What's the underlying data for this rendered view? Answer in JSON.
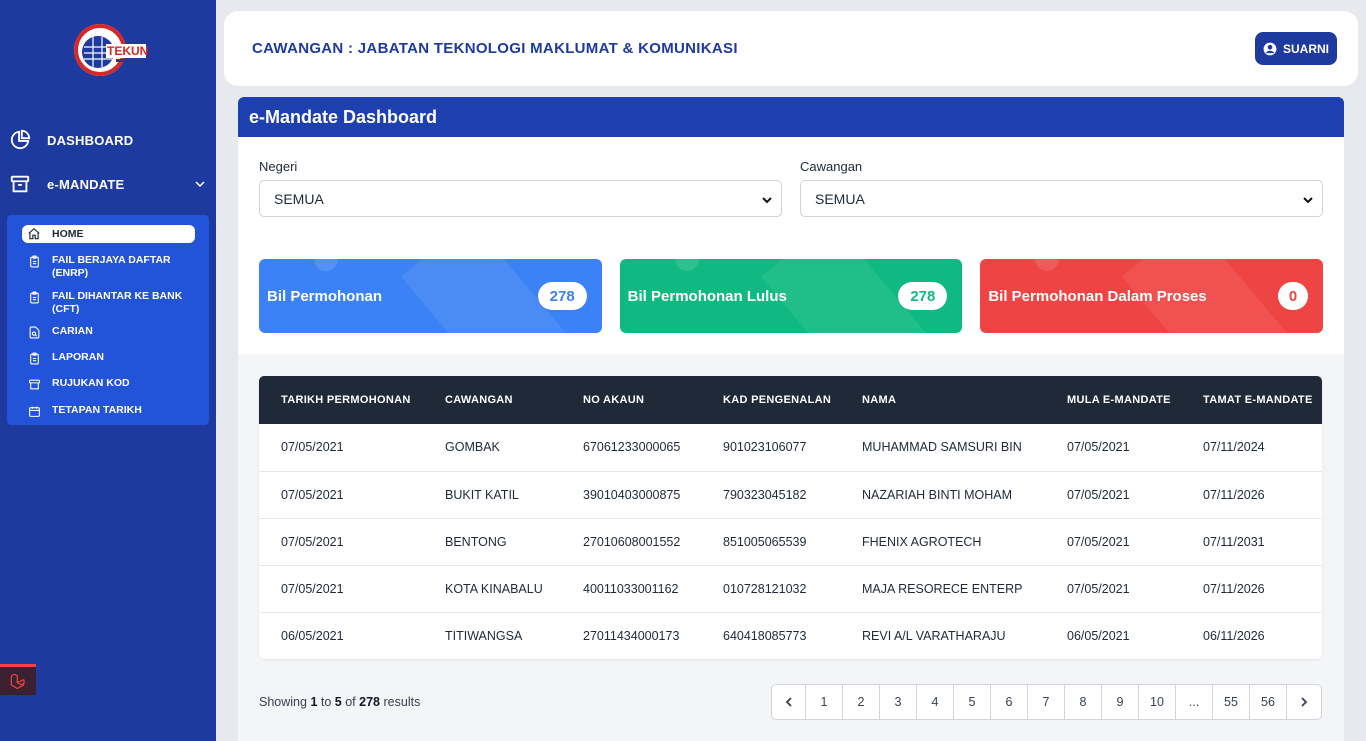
{
  "sidebar": {
    "logo_text": "TEKUN",
    "main_items": [
      {
        "label": "DASHBOARD",
        "icon": "pie-chart-icon"
      },
      {
        "label": "e-MANDATE",
        "icon": "archive-box-icon"
      }
    ],
    "sub_items": [
      {
        "label": "HOME",
        "icon": "home-icon",
        "active": true
      },
      {
        "label": "FAIL BERJAYA DAFTAR (ENRP)",
        "icon": "clipboard-icon"
      },
      {
        "label": "FAIL DIHANTAR KE BANK (CFT)",
        "icon": "clipboard-icon"
      },
      {
        "label": "CARIAN",
        "icon": "search-document-icon"
      },
      {
        "label": "LAPORAN",
        "icon": "clipboard-icon"
      },
      {
        "label": "RUJUKAN KOD",
        "icon": "archive-box-icon"
      },
      {
        "label": "TETAPAN TARIKH",
        "icon": "calendar-icon"
      }
    ]
  },
  "header": {
    "title": "CAWANGAN : JABATAN TEKNOLOGI MAKLUMAT & KOMUNIKASI",
    "user_name": "SUARNI"
  },
  "main": {
    "card_title": "e-Mandate Dashboard",
    "filters": {
      "negeri_label": "Negeri",
      "negeri_value": "SEMUA",
      "cawangan_label": "Cawangan",
      "cawangan_value": "SEMUA"
    },
    "stats": [
      {
        "label": "Bil Permohonan",
        "count": "278",
        "color": "#3b82f6"
      },
      {
        "label": "Bil Permohonan Lulus",
        "count": "278",
        "color": "#10b981"
      },
      {
        "label": "Bil Permohonan Dalam Proses",
        "count": "0",
        "color": "#ef4444"
      }
    ],
    "table": {
      "headers": [
        "TARIKH PERMOHONAN",
        "CAWANGAN",
        "NO AKAUN",
        "KAD PENGENALAN",
        "NAMA",
        "MULA E-MANDATE",
        "TAMAT E-MANDATE"
      ],
      "rows": [
        [
          "07/05/2021",
          "GOMBAK",
          "67061233000065",
          "901023106077",
          "MUHAMMAD SAMSURI BIN",
          "07/05/2021",
          "07/11/2024"
        ],
        [
          "07/05/2021",
          "BUKIT KATIL",
          "39010403000875",
          "790323045182",
          "NAZARIAH BINTI MOHAM",
          "07/05/2021",
          "07/11/2026"
        ],
        [
          "07/05/2021",
          "BENTONG",
          "27010608001552",
          "851005065539",
          "FHENIX AGROTECH",
          "07/05/2021",
          "07/11/2031"
        ],
        [
          "07/05/2021",
          "KOTA KINABALU",
          "40011033001162",
          "010728121032",
          "MAJA RESORECE ENTERP",
          "07/05/2021",
          "07/11/2026"
        ],
        [
          "06/05/2021",
          "TITIWANGSA",
          "27011434000173",
          "640418085773",
          "REVI A/L VARATHARAJU",
          "06/05/2021",
          "06/11/2026"
        ]
      ]
    },
    "pagination": {
      "showing_prefix": "Showing",
      "from": "1",
      "to_word": "to",
      "to": "5",
      "of_word": "of",
      "total": "278",
      "suffix": "results",
      "pages": [
        "1",
        "2",
        "3",
        "4",
        "5",
        "6",
        "7",
        "8",
        "9",
        "10",
        "...",
        "55",
        "56"
      ]
    }
  }
}
